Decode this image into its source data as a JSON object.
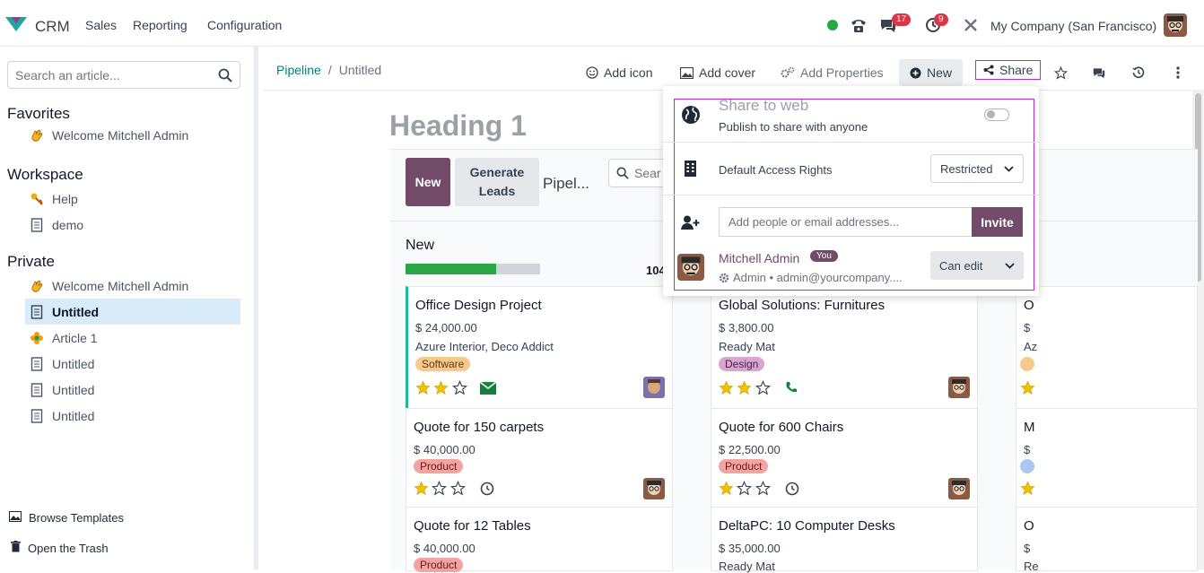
{
  "navbar": {
    "app_name": "CRM",
    "menus": [
      "Sales",
      "Reporting",
      "Configuration"
    ],
    "messages_count": "17",
    "activities_count": "9",
    "company": "My Company (San Francisco)",
    "status_color": "#28a745"
  },
  "sidebar": {
    "search_placeholder": "Search an article...",
    "favorites_title": "Favorites",
    "favorites": [
      {
        "label": "Welcome Mitchell Admin",
        "icon": "waving-hand-icon"
      }
    ],
    "workspace_title": "Workspace",
    "workspace": [
      {
        "label": "Help",
        "icon": "key-icon"
      },
      {
        "label": "demo",
        "icon": "document-icon"
      }
    ],
    "private_title": "Private",
    "private": [
      {
        "label": "Welcome Mitchell Admin",
        "icon": "waving-hand-icon"
      },
      {
        "label": "Untitled",
        "icon": "document-icon"
      },
      {
        "label": "Article 1",
        "icon": "flower-icon"
      },
      {
        "label": "Untitled",
        "icon": "document-icon"
      },
      {
        "label": "Untitled",
        "icon": "document-icon"
      },
      {
        "label": "Untitled",
        "icon": "document-icon"
      }
    ],
    "browse_templates": "Browse Templates",
    "open_trash": "Open the Trash"
  },
  "breadcrumb": {
    "parent": "Pipeline",
    "separator": "/",
    "current": "Untitled"
  },
  "toolbar": {
    "add_icon": "Add icon",
    "add_cover": "Add cover",
    "add_properties": "Add Properties",
    "new": "New",
    "share": "Share"
  },
  "article": {
    "heading": "Heading 1"
  },
  "kanban": {
    "new_button": "New",
    "generate_leads": "Generate Leads",
    "title": "Pipel...",
    "search_placeholder": "Sear",
    "column_title": "New",
    "column_count": "104",
    "progress": 0.67,
    "cards_col1": [
      {
        "name": "Office Design Project",
        "amount": "$ 24,000.00",
        "customer": "Azure Interior, Deco Addict",
        "tag": "Software",
        "stars": 2
      },
      {
        "name": "Quote for 150 carpets",
        "amount": "$ 40,000.00",
        "customer": "",
        "tag": "Product",
        "stars": 1
      },
      {
        "name": "Quote for 12 Tables",
        "amount": "$ 40,000.00",
        "customer": "",
        "tag": "Product",
        "stars": 0
      }
    ],
    "cards_col2": [
      {
        "name": "Global Solutions: Furnitures",
        "amount": "$ 3,800.00",
        "customer": "Ready Mat",
        "tag": "Design",
        "stars": 2
      },
      {
        "name": "Quote for 600 Chairs",
        "amount": "$ 22,500.00",
        "customer": "",
        "tag": "Product",
        "stars": 1
      },
      {
        "name": "DeltaPC: 10 Computer Desks",
        "amount": "$ 35,000.00",
        "customer": "Ready Mat",
        "tag": "",
        "stars": 0
      }
    ],
    "col3_peek": [
      {
        "name": "O",
        "amount": "$",
        "customer": "Az"
      },
      {
        "name": "M",
        "amount": "$",
        "customer": ""
      },
      {
        "name": "O",
        "amount": "$",
        "customer": "Re"
      }
    ]
  },
  "share_popover": {
    "share_web_title": "Share to web",
    "share_web_sub": "Publish to share with anyone",
    "access_label": "Default Access Rights",
    "access_value": "Restricted",
    "invite_placeholder": "Add people or email addresses...",
    "invite_button": "Invite",
    "user_name": "Mitchell Admin",
    "you_badge": "You",
    "user_sub": "Admin • admin@yourcompany....",
    "role_value": "Can edit"
  },
  "colors": {
    "brand": "#714b67",
    "teal": "#017e84",
    "highlight": "#c026d3"
  }
}
